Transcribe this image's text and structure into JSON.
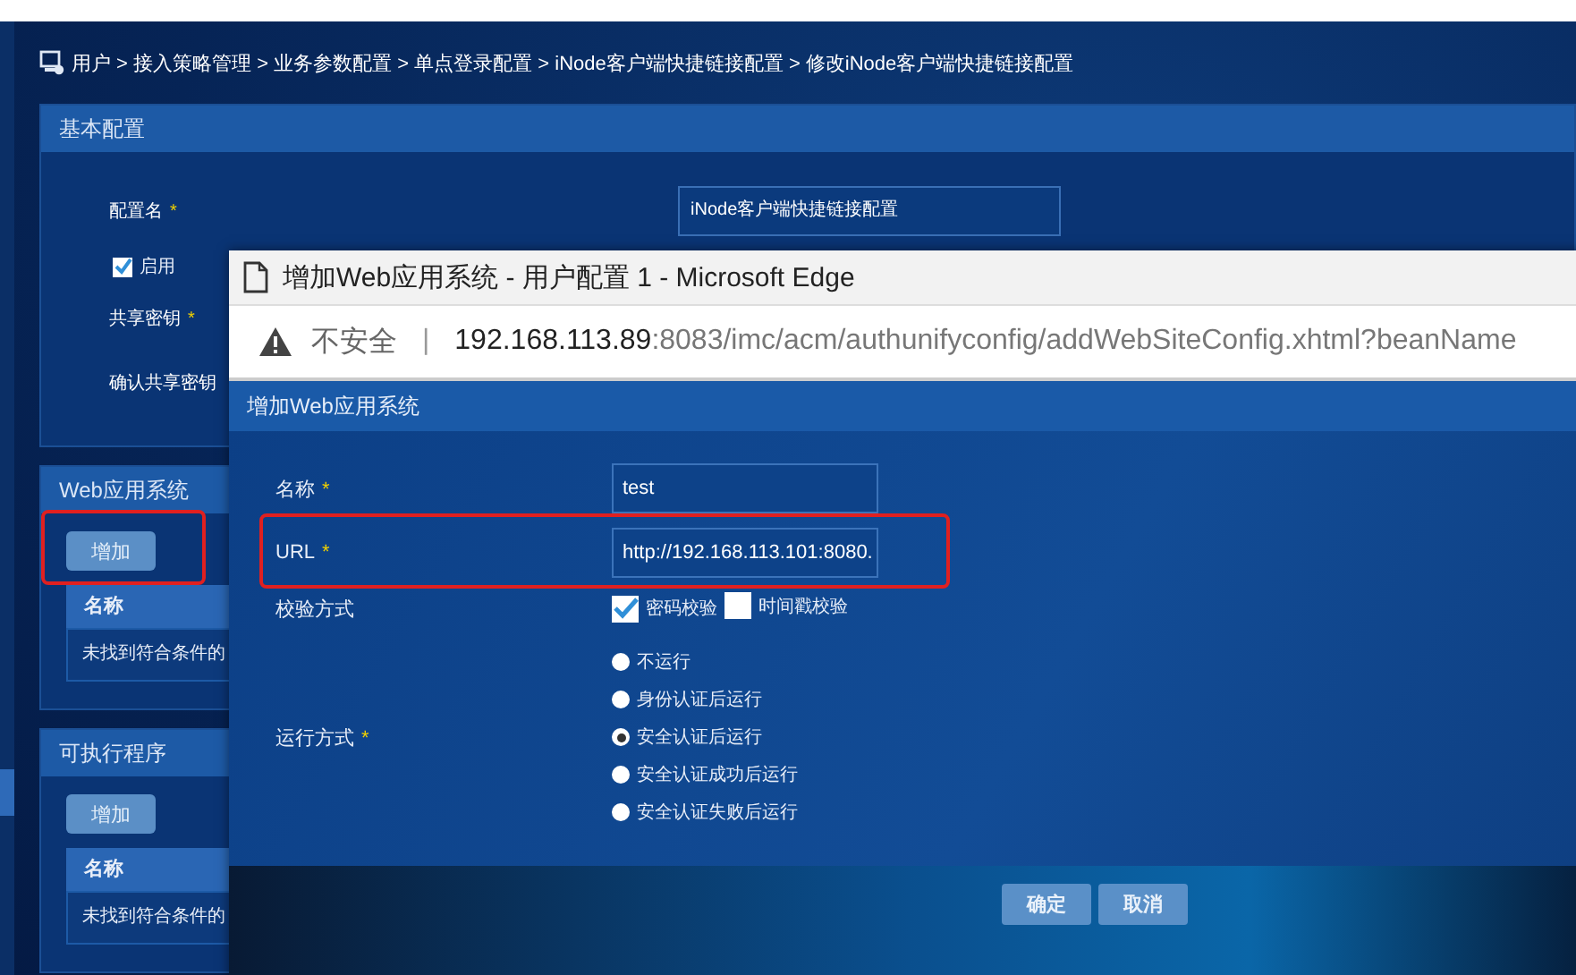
{
  "breadcrumb": "用户 > 接入策略管理 > 业务参数配置 > 单点登录配置 > iNode客户端快捷链接配置 > 修改iNode客户端快捷链接配置",
  "basic_panel": {
    "title": "基本配置",
    "fields": [
      {
        "label": "配置名",
        "mark": "*",
        "value": "iNode客户端快捷链接配置"
      },
      {
        "kind": "checkbox",
        "label": "启用",
        "checked": true
      },
      {
        "label": "共享密钥",
        "mark": "*"
      },
      {
        "label": "确认共享密钥"
      }
    ]
  },
  "side_panels": [
    {
      "title": "Web应用系统",
      "button": "增加",
      "highlighted": true,
      "column": "名称",
      "empty_text": "未找到符合条件的"
    },
    {
      "title": "可执行程序",
      "button": "增加",
      "highlighted": false,
      "column": "名称",
      "empty_text": "未找到符合条件的"
    }
  ],
  "popup": {
    "window_title": "增加Web应用系统 - 用户配置 1 - Microsoft Edge",
    "security": "不安全",
    "separator": "|",
    "url_host": "192.168.113.89",
    "url_rest": ":8083/imc/acm/authunifyconfig/addWebSiteConfig.xhtml?beanName",
    "dialog_title": "增加Web应用系统",
    "rows": [
      {
        "kind": "input",
        "label": "名称",
        "mark": "*",
        "value": "test",
        "highlighted": false
      },
      {
        "kind": "input",
        "label": "URL",
        "mark": "*",
        "value": "http://192.168.113.101:8080.",
        "highlighted": true
      },
      {
        "kind": "checks",
        "label": "校验方式",
        "highlighted": false,
        "options": [
          {
            "label": "密码校验",
            "checked": true
          },
          {
            "label": "时间戳校验",
            "checked": false
          }
        ]
      },
      {
        "kind": "radios",
        "label": "运行方式",
        "mark": "*",
        "highlighted": false,
        "options": [
          {
            "label": "不运行",
            "selected": false
          },
          {
            "label": "身份认证后运行",
            "selected": false
          },
          {
            "label": "安全认证后运行",
            "selected": true
          },
          {
            "label": "安全认证成功后运行",
            "selected": false
          },
          {
            "label": "安全认证失败后运行",
            "selected": false
          }
        ]
      }
    ],
    "buttons": [
      "确定",
      "取消"
    ]
  }
}
